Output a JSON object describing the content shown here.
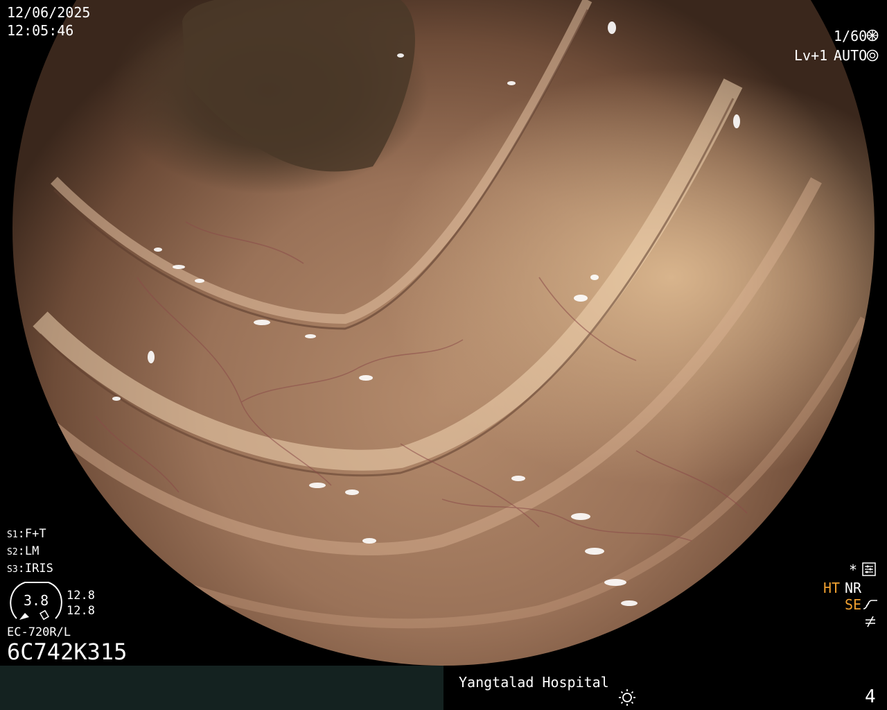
{
  "overlay": {
    "date": "12/06/2025",
    "time": "12:05:46",
    "shutter": "1/60",
    "level": "Lv+1",
    "iris_mode": "AUTO",
    "switches": [
      {
        "key": "S1",
        "value": "F+T"
      },
      {
        "key": "S2",
        "value": "LM"
      },
      {
        "key": "S3",
        "value": "IRIS"
      }
    ],
    "gauge_value": "3.8",
    "gauge_top": "12.8",
    "gauge_bottom": "12.8",
    "scope_model": "EC-720R/L",
    "serial": "6C742K315",
    "right_status": {
      "asterisk": "*",
      "ht": "HT",
      "nr": "NR",
      "se": "SE"
    }
  },
  "footer": {
    "hospital": "Yangtalad Hospital",
    "page_number": "4"
  },
  "icons": [
    "shutter-icon",
    "iris-icon",
    "settings-icon",
    "curve-icon",
    "not-equal-icon",
    "light-icon"
  ],
  "colors": {
    "status_orange": "#f0a030",
    "bar_dark": "#142220"
  }
}
